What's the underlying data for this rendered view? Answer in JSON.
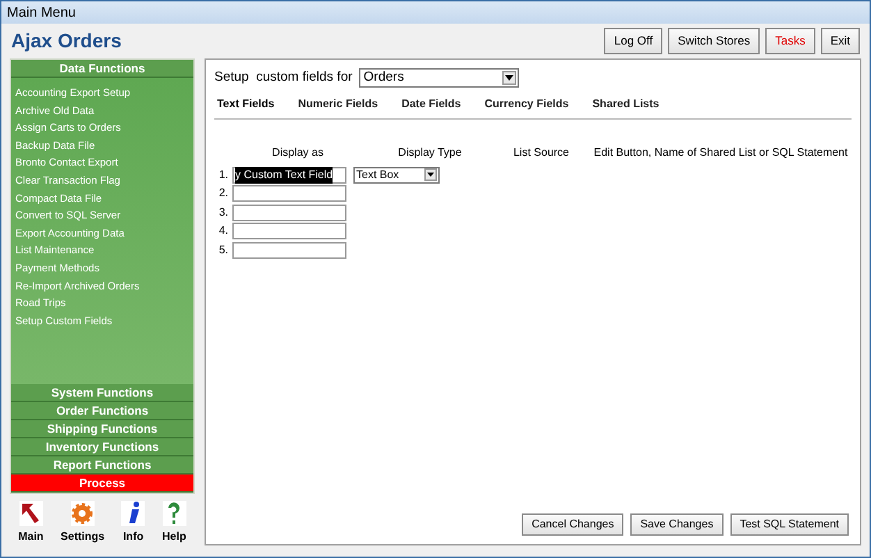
{
  "window": {
    "title": "Main Menu"
  },
  "app_title": "Ajax Orders",
  "header_buttons": [
    {
      "label": "Log Off",
      "alert": false
    },
    {
      "label": "Switch Stores",
      "alert": false
    },
    {
      "label": "Tasks",
      "alert": true
    },
    {
      "label": "Exit",
      "alert": false
    }
  ],
  "sidebar": {
    "sections": [
      {
        "label": "Data Functions",
        "highlighted": false,
        "items": [
          "Accounting Export Setup",
          "Archive Old Data",
          "Assign Carts to Orders",
          "Backup Data File",
          "Bronto Contact Export",
          "Clear Transaction Flag",
          "Compact Data File",
          "Convert to SQL Server",
          "Export Accounting Data",
          "List Maintenance",
          "Payment Methods",
          "Re-Import Archived Orders",
          "Road Trips",
          "Setup Custom Fields"
        ]
      },
      {
        "label": "System Functions",
        "highlighted": false
      },
      {
        "label": "Order Functions",
        "highlighted": false
      },
      {
        "label": "Shipping Functions",
        "highlighted": false
      },
      {
        "label": "Inventory Functions",
        "highlighted": false
      },
      {
        "label": "Report Functions",
        "highlighted": false
      },
      {
        "label": "Process",
        "highlighted": true
      }
    ],
    "shortcuts": [
      {
        "label": "Main",
        "kind": "arrow"
      },
      {
        "label": "Settings",
        "kind": "gear"
      },
      {
        "label": "Info",
        "kind": "info"
      },
      {
        "label": "Help",
        "kind": "help"
      }
    ]
  },
  "setup": {
    "label": "Setup  custom fields for",
    "value": "Orders"
  },
  "tabs": [
    {
      "label": "Text Fields",
      "selected": true
    },
    {
      "label": "Numeric Fields",
      "selected": false
    },
    {
      "label": "Date Fields",
      "selected": false
    },
    {
      "label": "Currency Fields",
      "selected": false
    },
    {
      "label": "Shared Lists",
      "selected": false
    }
  ],
  "columns": [
    "Display as",
    "Display Type",
    "List Source",
    "Edit Button, Name of Shared List or SQL Statement"
  ],
  "rows": [
    {
      "number": "1.",
      "display_as": "y Custom Text Field",
      "text_selected": true,
      "display_type": "Text Box"
    },
    {
      "number": "2."
    },
    {
      "number": "3."
    },
    {
      "number": "4."
    },
    {
      "number": "5."
    }
  ],
  "footer_buttons": [
    "Cancel Changes",
    "Save Changes",
    "Test SQL Statement"
  ]
}
